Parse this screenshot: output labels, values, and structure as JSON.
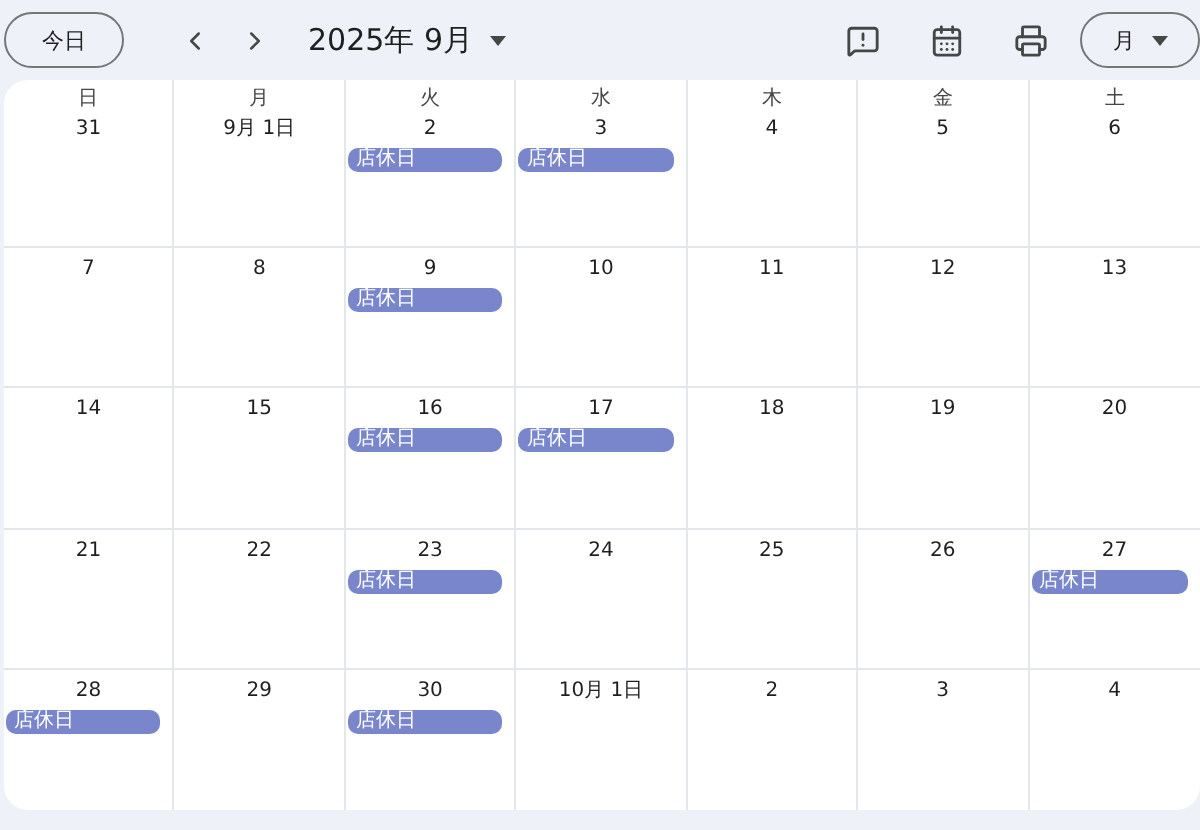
{
  "toolbar": {
    "today_button": "今日",
    "title": "2025年 9月",
    "view_button": "月"
  },
  "weekdays": [
    "日",
    "月",
    "火",
    "水",
    "木",
    "金",
    "土"
  ],
  "weeks": [
    {
      "days": [
        {
          "date": "31"
        },
        {
          "date": "9月 1日"
        },
        {
          "date": "2",
          "events": [
            "店休日"
          ]
        },
        {
          "date": "3",
          "events": [
            "店休日"
          ]
        },
        {
          "date": "4"
        },
        {
          "date": "5"
        },
        {
          "date": "6"
        }
      ]
    },
    {
      "days": [
        {
          "date": "7"
        },
        {
          "date": "8"
        },
        {
          "date": "9",
          "events": [
            "店休日"
          ]
        },
        {
          "date": "10"
        },
        {
          "date": "11"
        },
        {
          "date": "12"
        },
        {
          "date": "13"
        }
      ]
    },
    {
      "days": [
        {
          "date": "14"
        },
        {
          "date": "15"
        },
        {
          "date": "16",
          "events": [
            "店休日"
          ]
        },
        {
          "date": "17",
          "events": [
            "店休日"
          ]
        },
        {
          "date": "18"
        },
        {
          "date": "19"
        },
        {
          "date": "20"
        }
      ]
    },
    {
      "days": [
        {
          "date": "21"
        },
        {
          "date": "22"
        },
        {
          "date": "23",
          "events": [
            "店休日"
          ]
        },
        {
          "date": "24"
        },
        {
          "date": "25"
        },
        {
          "date": "26"
        },
        {
          "date": "27",
          "events": [
            "店休日"
          ]
        }
      ]
    },
    {
      "days": [
        {
          "date": "28",
          "events": [
            "店休日"
          ]
        },
        {
          "date": "29"
        },
        {
          "date": "30",
          "events": [
            "店休日"
          ]
        },
        {
          "date": "10月 1日"
        },
        {
          "date": "2"
        },
        {
          "date": "3"
        },
        {
          "date": "4"
        }
      ]
    }
  ]
}
